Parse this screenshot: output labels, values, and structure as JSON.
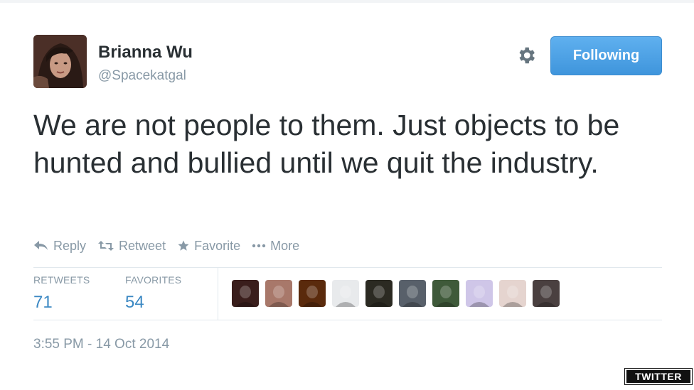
{
  "user": {
    "display_name": "Brianna Wu",
    "handle": "@Spacekatgal"
  },
  "follow_button": {
    "label": "Following",
    "color": "#4a9ee3"
  },
  "tweet": {
    "text": "We are not people to them. Just objects to be hunted and bullied until we quit the industry."
  },
  "actions": [
    {
      "label": "Reply",
      "icon": "reply-icon"
    },
    {
      "label": "Retweet",
      "icon": "retweet-icon"
    },
    {
      "label": "Favorite",
      "icon": "star-icon"
    },
    {
      "label": "More",
      "icon": "more-icon"
    }
  ],
  "stats": {
    "retweets_label": "RETWEETS",
    "retweets_value": "71",
    "favorites_label": "FAVORITES",
    "favorites_value": "54"
  },
  "favorited_by_avatars": [
    {
      "icon": "user-avatar",
      "color": "#3a1e1c"
    },
    {
      "icon": "user-avatar",
      "color": "#a8786a"
    },
    {
      "icon": "user-avatar",
      "color": "#5a2a0c"
    },
    {
      "icon": "user-avatar",
      "color": "#e8eaec"
    },
    {
      "icon": "user-avatar",
      "color": "#2b2a22"
    },
    {
      "icon": "user-avatar",
      "color": "#58606a"
    },
    {
      "icon": "user-avatar",
      "color": "#3f5a3a"
    },
    {
      "icon": "user-avatar",
      "color": "#cfc6e8"
    },
    {
      "icon": "user-avatar",
      "color": "#e5d4cf"
    },
    {
      "icon": "user-avatar",
      "color": "#4a4040"
    }
  ],
  "timestamp": "3:55 PM - 14 Oct 2014",
  "watermark": "TWITTER"
}
